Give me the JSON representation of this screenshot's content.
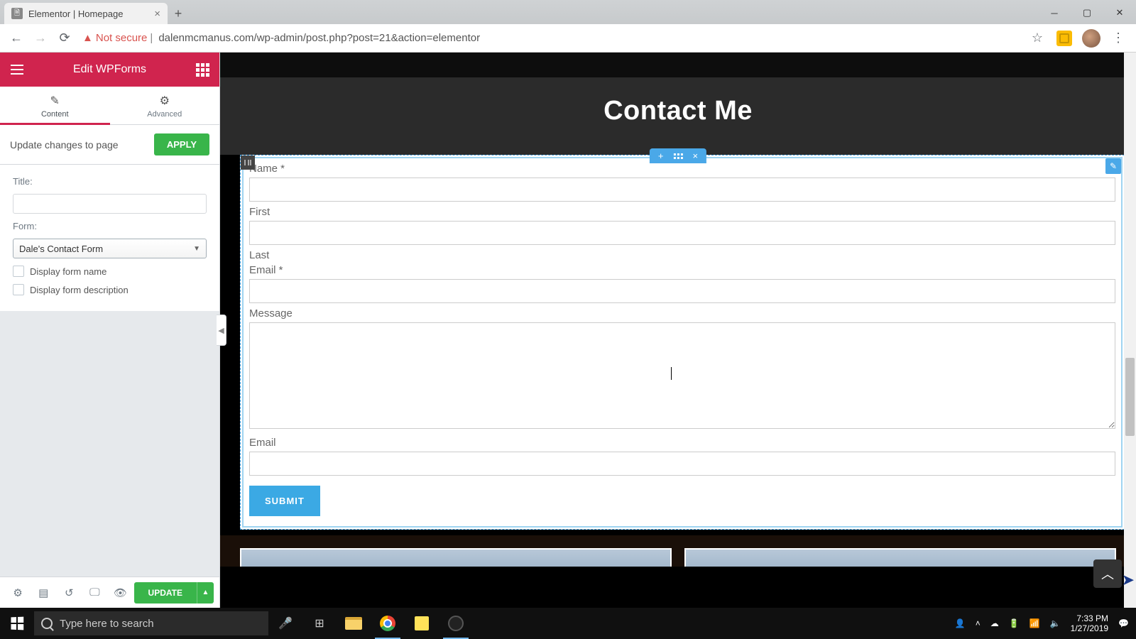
{
  "browser": {
    "tab_title": "Elementor | Homepage",
    "not_secure": "Not secure",
    "url": "dalenmcmanus.com/wp-admin/post.php?post=21&action=elementor"
  },
  "sidebar": {
    "header_title": "Edit WPForms",
    "tabs": {
      "content": "Content",
      "advanced": "Advanced"
    },
    "apply_row": {
      "text": "Update changes to page",
      "button": "APPLY"
    },
    "fields": {
      "title_label": "Title:",
      "title_value": "",
      "form_label": "Form:",
      "form_selected": "Dale's Contact Form",
      "chk_name": "Display form name",
      "chk_desc": "Display form description"
    },
    "footer": {
      "update": "UPDATE"
    }
  },
  "preview": {
    "heading": "Contact Me",
    "form": {
      "name_label": "Name *",
      "first_label": "First",
      "last_label": "Last",
      "email_req_label": "Email *",
      "message_label": "Message",
      "email_label": "Email",
      "submit": "SUBMIT"
    }
  },
  "taskbar": {
    "search_placeholder": "Type here to search",
    "time": "7:33 PM",
    "date": "1/27/2019"
  }
}
